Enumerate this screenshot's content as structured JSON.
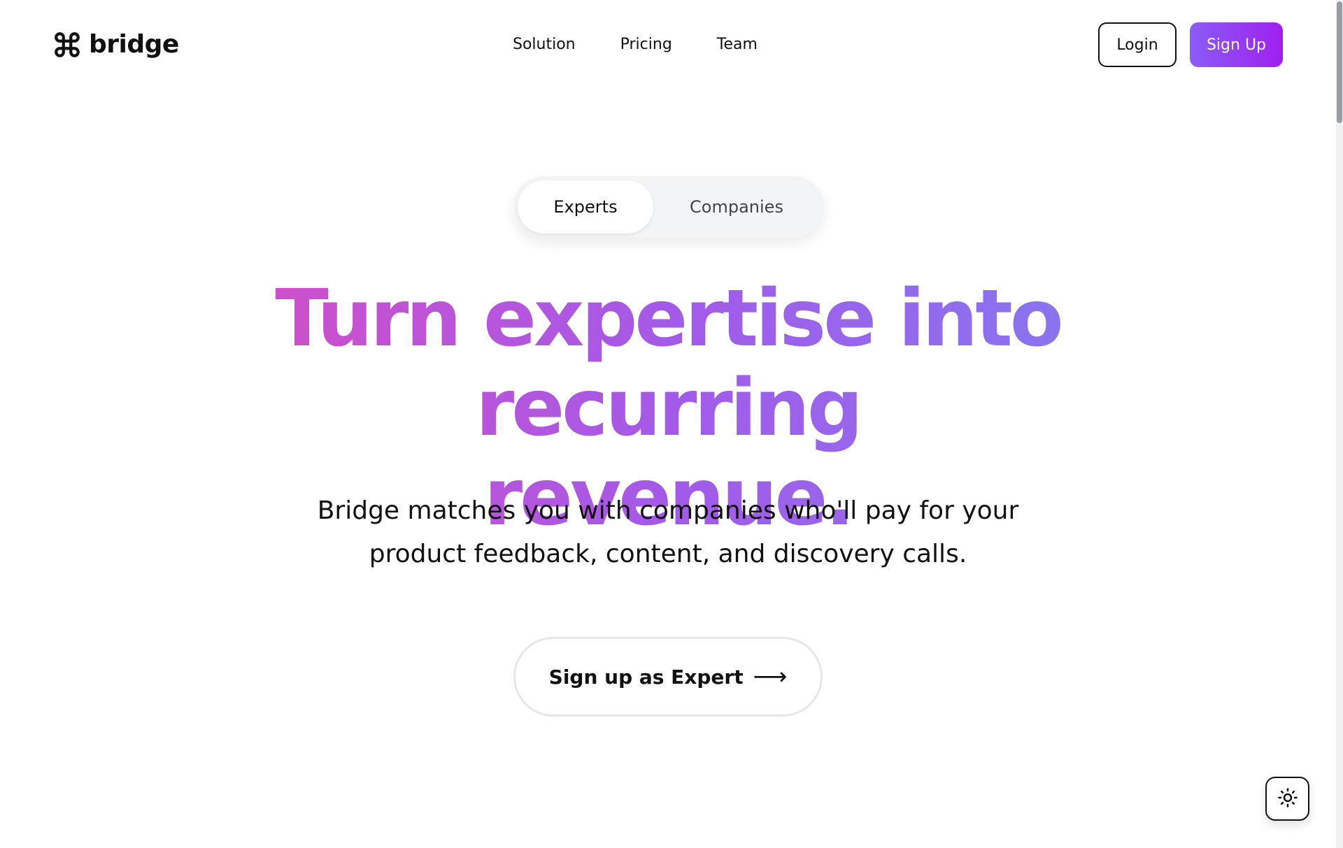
{
  "header": {
    "brand": "bridge",
    "nav": [
      "Solution",
      "Pricing",
      "Team"
    ],
    "login_label": "Login",
    "signup_label": "Sign Up"
  },
  "audience_toggle": {
    "options": [
      "Experts",
      "Companies"
    ],
    "selected": "Experts"
  },
  "hero": {
    "title_line1": "Turn expertise into recurring",
    "title_line2": "revenue.",
    "subtitle_line1": "Bridge matches you with companies who'll pay for your",
    "subtitle_line2": "product feedback, content, and discovery calls.",
    "cta_label": "Sign up as Expert",
    "cta_arrow": "⟶"
  },
  "theme_toggle": {
    "icon": "sun-icon"
  },
  "colors": {
    "gradient_start": "#df4bbf",
    "gradient_mid": "#a35ae8",
    "gradient_end": "#7f7ef2",
    "signup_start": "#8b5cf6",
    "signup_end": "#a020f0",
    "text": "#111111"
  },
  "icons": {
    "logo": "command-key-icon"
  }
}
